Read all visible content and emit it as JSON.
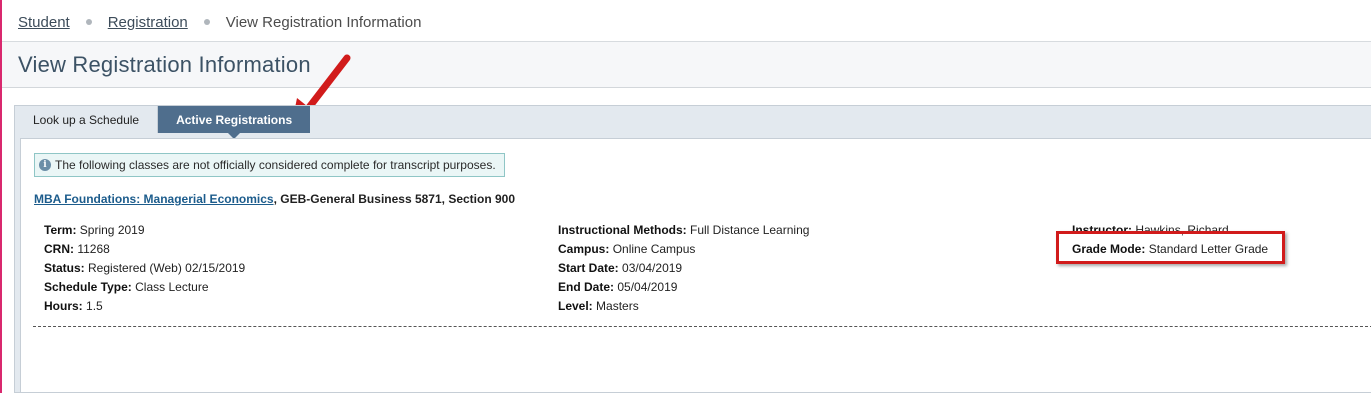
{
  "breadcrumb": {
    "items": [
      "Student",
      "Registration"
    ],
    "current": "View Registration Information"
  },
  "page": {
    "title": "View Registration Information"
  },
  "tabs": [
    {
      "label": "Look up a Schedule",
      "active": false
    },
    {
      "label": "Active Registrations",
      "active": true
    }
  ],
  "notice": {
    "icon": "info-icon",
    "text": "The following classes are not officially considered complete for transcript purposes."
  },
  "course": {
    "link": "MBA Foundations: Managerial Economics",
    "rest": ", GEB-General Business 5871, Section 900"
  },
  "details": {
    "col1": [
      {
        "label": "Term:",
        "value": "Spring 2019"
      },
      {
        "label": "CRN:",
        "value": "11268"
      },
      {
        "label": "Status:",
        "value": "Registered (Web) 02/15/2019"
      },
      {
        "label": "Schedule Type:",
        "value": "Class Lecture"
      },
      {
        "label": "Hours:",
        "value": "1.5"
      }
    ],
    "col2": [
      {
        "label": "Instructional Methods:",
        "value": "Full Distance Learning"
      },
      {
        "label": "Campus:",
        "value": "Online Campus"
      },
      {
        "label": "Start Date:",
        "value": "03/04/2019"
      },
      {
        "label": "End Date:",
        "value": "05/04/2019"
      },
      {
        "label": "Level:",
        "value": "Masters"
      }
    ],
    "col3": [
      {
        "label": "Instructor:",
        "value": "Hawkins, Richard"
      },
      {
        "label": "Grade Mode:",
        "value": "Standard Letter Grade"
      }
    ]
  },
  "colors": {
    "accent_tab": "#4f6e8d",
    "annotation_red": "#d11b1b",
    "left_border": "#d9286e"
  }
}
